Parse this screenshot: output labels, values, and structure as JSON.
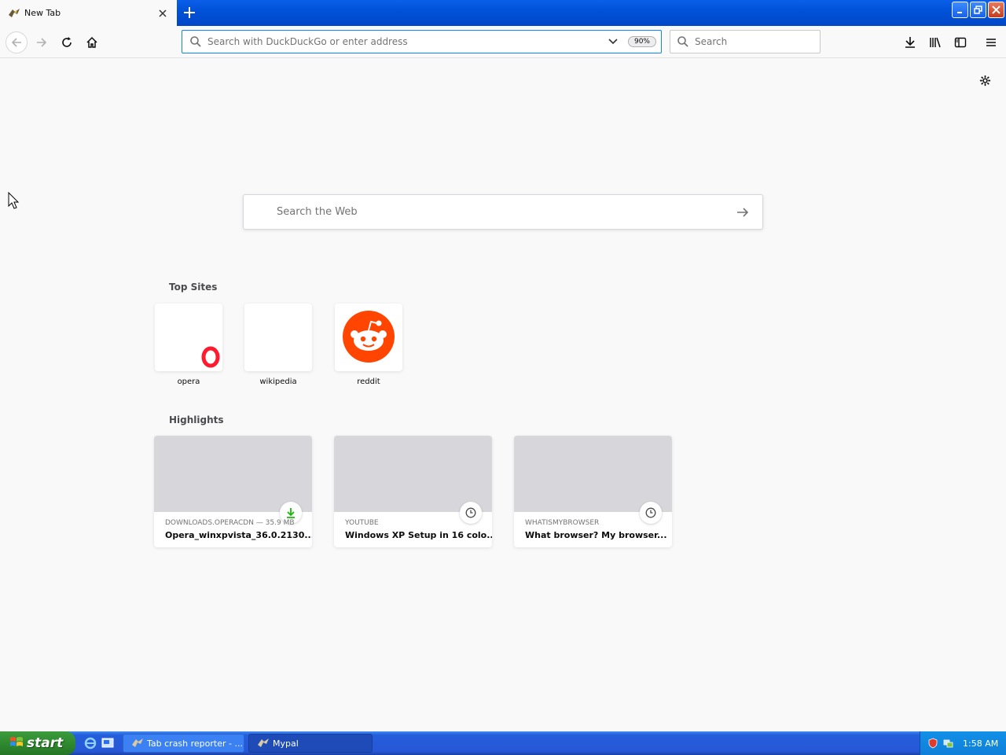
{
  "browser": {
    "tab": {
      "title": "New Tab"
    },
    "urlbar": {
      "placeholder": "Search with DuckDuckGo or enter address",
      "zoom": "90%"
    },
    "searchbar": {
      "placeholder": "Search"
    }
  },
  "newtab": {
    "websearch_placeholder": "Search the Web",
    "topsites_title": "Top Sites",
    "topsites": [
      {
        "label": "opera",
        "icon": "opera-logo-icon"
      },
      {
        "label": "wikipedia",
        "icon": ""
      },
      {
        "label": "reddit",
        "icon": "reddit-logo-icon"
      }
    ],
    "highlights_title": "Highlights",
    "highlights": [
      {
        "source": "DOWNLOADS.OPERACDN — 35.9 MB",
        "title": "Opera_winxpvista_36.0.2130....",
        "badge": "download-icon"
      },
      {
        "source": "YOUTUBE",
        "title": "Windows XP Setup in 16 colo...",
        "badge": "clock-icon"
      },
      {
        "source": "WHATISMYBROWSER",
        "title": "What browser? My browser...",
        "badge": "clock-icon"
      }
    ]
  },
  "taskbar": {
    "start_label": "start",
    "tasks": [
      {
        "label": "Tab crash reporter - ..."
      },
      {
        "label": "Mypal"
      }
    ],
    "clock": "1:58 AM"
  },
  "colors": {
    "accent": "#0a84ff",
    "reddit": "#ff4500",
    "opera": "#ff1b2d",
    "xp_blue": "#245edb",
    "xp_start_green": "#2f8a2f"
  }
}
